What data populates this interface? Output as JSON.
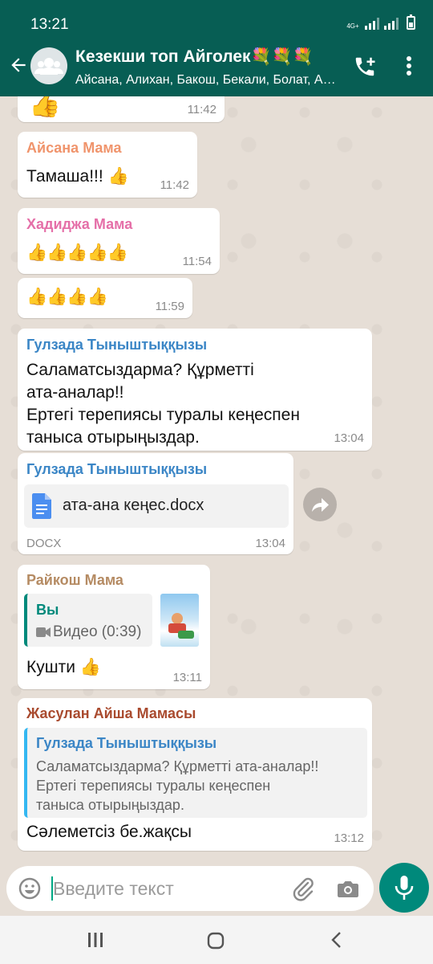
{
  "status_bar": {
    "time": "13:21",
    "network": "4G+"
  },
  "header": {
    "title": "Кезекши топ Айголек💐💐💐",
    "subtitle": "Айсана, Алихан, Бакош, Бекали, Болат, Айдана, Гулзада"
  },
  "messages": [
    {
      "time": "11:42"
    },
    {
      "sender": "Айсана Мама",
      "sender_color": "#f0946c",
      "text": "Тамаша!!! 👍",
      "time": "11:42"
    },
    {
      "sender": "Хадиджа Мама",
      "sender_color": "#e56fa8",
      "text": "👍👍👍👍👍",
      "time": "11:54"
    },
    {
      "text": "👍👍👍👍",
      "time": "11:59"
    },
    {
      "sender": "Гулзада Тыныштыққызы",
      "sender_color": "#3b86c6",
      "lines": [
        "Саламатсыздарма? Құрметті",
        "ата-аналар!!",
        "Ертегі терепиясы туралы   кеңеспен",
        "таныса отырыңыздар."
      ],
      "time": "13:04"
    },
    {
      "sender": "Гулзада Тыныштыққызы",
      "sender_color": "#3b86c6",
      "file_name": "ата-ана кеңес.docx",
      "file_type": "DOCX",
      "time": "13:04"
    },
    {
      "sender": "Райкош Мама",
      "sender_color": "#b58b63",
      "reply": {
        "author": "Вы",
        "author_color": "#00897b",
        "text": "Видео (0:39)"
      },
      "text": "Кушти 👍",
      "time": "13:11"
    },
    {
      "sender": "Жасулан Айша Мамасы",
      "sender_color": "#a94a2e",
      "reply": {
        "author": "Гулзада Тыныштыққызы",
        "author_color": "#3b86c6",
        "lines": [
          "Саламатсыздарма? Құрметті ата-аналар!!",
          "Ертегі терепиясы туралы   кеңеспен",
          "таныса отырыңыздар."
        ]
      },
      "text": "Сәлеметсіз бе.жақсы",
      "time": "13:12"
    }
  ],
  "input": {
    "placeholder": "Введите текст"
  },
  "icons": {
    "back": "arrow-left-icon",
    "avatar": "group-avatar-icon",
    "call": "add-call-icon",
    "menu": "more-vert-icon",
    "emoji": "emoji-icon",
    "attach": "paperclip-icon",
    "camera": "camera-icon",
    "mic": "mic-icon",
    "doc": "document-icon",
    "video": "video-icon",
    "forward": "forward-icon",
    "nav_recent": "recents-icon",
    "nav_home": "home-icon",
    "nav_back": "back-nav-icon"
  },
  "colors": {
    "primary": "#075e54",
    "accent": "#00897b",
    "chat_bg": "#e6ded6"
  }
}
